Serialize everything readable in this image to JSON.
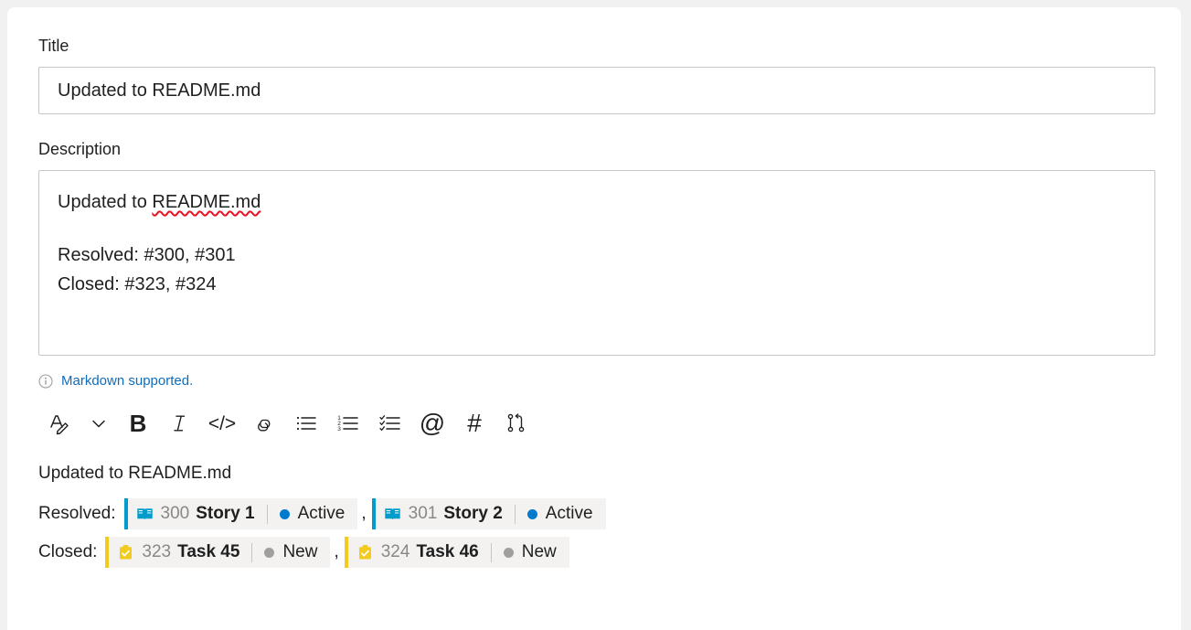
{
  "form": {
    "title_label": "Title",
    "title_value": "Updated to README.md",
    "description_label": "Description",
    "description_lines": [
      "Updated to README.md",
      "",
      "Resolved: #300, #301",
      "Closed: #323, #324"
    ],
    "description_line1_prefix": "Updated to ",
    "description_line1_spellcheck": "README.md",
    "description_line3": "Resolved: #300, #301",
    "description_line4": "Closed: #323, #324"
  },
  "markdown_hint": {
    "icon": "info-icon",
    "link_text": "Markdown supported."
  },
  "toolbar": {
    "items": [
      {
        "name": "font-style-icon",
        "glyph": "A",
        "kind": "font"
      },
      {
        "name": "chevron-down-icon",
        "glyph": "⌄",
        "kind": "chevron"
      },
      {
        "name": "bold-icon",
        "glyph": "B",
        "kind": "bold"
      },
      {
        "name": "italic-icon",
        "glyph": "I",
        "kind": "italic"
      },
      {
        "name": "code-icon",
        "glyph": "</>",
        "kind": "code"
      },
      {
        "name": "link-icon",
        "glyph": "⚭",
        "kind": "link"
      },
      {
        "name": "bulleted-list-icon",
        "glyph": "☰",
        "kind": "ul"
      },
      {
        "name": "numbered-list-icon",
        "glyph": "☰",
        "kind": "ol"
      },
      {
        "name": "checklist-icon",
        "glyph": "☰",
        "kind": "checklist"
      },
      {
        "name": "mention-icon",
        "glyph": "@",
        "kind": "at"
      },
      {
        "name": "hashtag-icon",
        "glyph": "#",
        "kind": "hash"
      },
      {
        "name": "pull-request-icon",
        "glyph": "⎇",
        "kind": "pr"
      }
    ]
  },
  "preview": {
    "heading": "Updated to README.md",
    "rows": [
      {
        "label": "Resolved:",
        "chips": [
          {
            "type": "story",
            "icon": "user-story-icon",
            "id": "300",
            "title": "Story 1",
            "state": "Active",
            "state_color": "#007acc",
            "accent": "#009ccc"
          },
          {
            "type": "story",
            "icon": "user-story-icon",
            "id": "301",
            "title": "Story 2",
            "state": "Active",
            "state_color": "#007acc",
            "accent": "#009ccc"
          }
        ],
        "separator": ","
      },
      {
        "label": "Closed:",
        "chips": [
          {
            "type": "task",
            "icon": "task-icon",
            "id": "323",
            "title": "Task 45",
            "state": "New",
            "state_color": "#a19f9d",
            "accent": "#f2cb1d"
          },
          {
            "type": "task",
            "icon": "task-icon",
            "id": "324",
            "title": "Task 46",
            "state": "New",
            "state_color": "#a19f9d",
            "accent": "#f2cb1d"
          }
        ],
        "separator": ","
      }
    ]
  },
  "colors": {
    "link": "#0f6cbd",
    "story_accent": "#009ccc",
    "task_accent": "#f2cb1d",
    "active_state": "#007acc",
    "new_state": "#a19f9d",
    "spellcheck_underline": "#e81123",
    "chip_background": "#f3f2f1"
  }
}
